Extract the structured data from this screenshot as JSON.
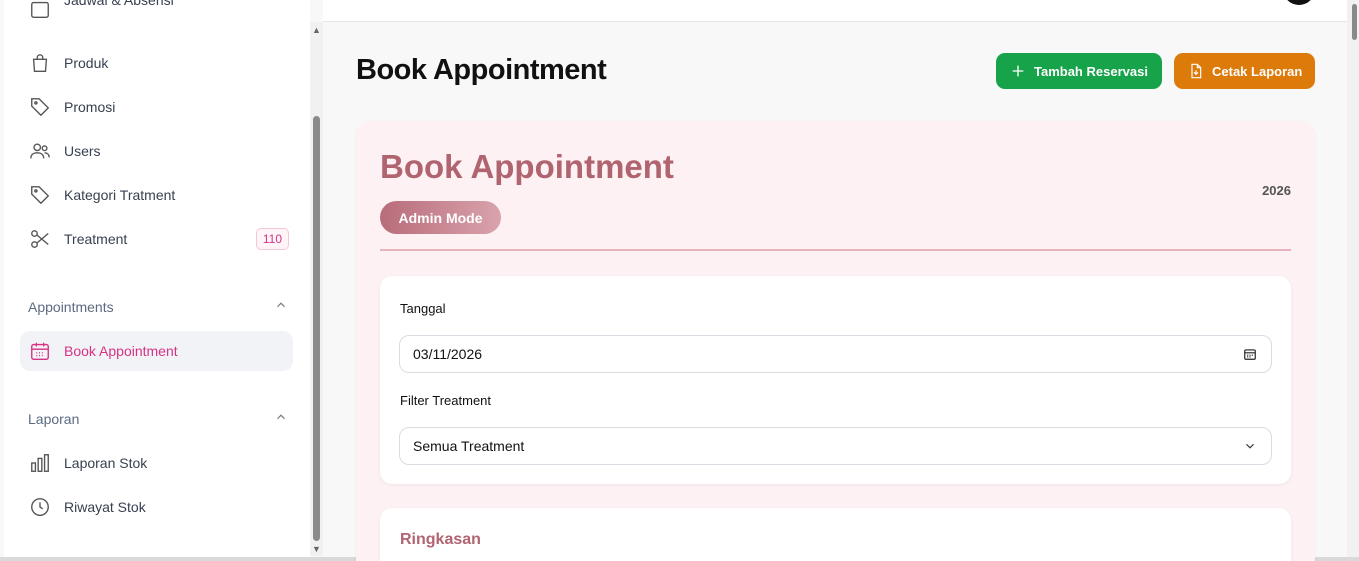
{
  "sidebar": {
    "items": [
      {
        "label": "Jadwal & Absensi",
        "icon": "calendar-icon"
      },
      {
        "label": "Produk",
        "icon": "shopping-bag-icon"
      },
      {
        "label": "Promosi",
        "icon": "tag-icon"
      },
      {
        "label": "Users",
        "icon": "users-icon"
      },
      {
        "label": "Kategori Tratment",
        "icon": "tag-icon"
      },
      {
        "label": "Treatment",
        "icon": "scissors-icon",
        "badge": "110"
      }
    ],
    "sections": [
      {
        "label": "Appointments",
        "items": [
          {
            "label": "Book Appointment",
            "icon": "calendar-icon",
            "active": true
          }
        ]
      },
      {
        "label": "Laporan",
        "items": [
          {
            "label": "Laporan Stok",
            "icon": "bar-chart-icon"
          },
          {
            "label": "Riwayat Stok",
            "icon": "clock-icon"
          }
        ]
      }
    ]
  },
  "header": {
    "title": "Book Appointment",
    "add_button": "Tambah Reservasi",
    "print_button": "Cetak Laporan"
  },
  "card": {
    "title": "Book Appointment",
    "year": "2026",
    "mode": "Admin Mode"
  },
  "form": {
    "date_label": "Tanggal",
    "date_value": "03/11/2026",
    "filter_label": "Filter Treatment",
    "filter_value": "Semua Treatment"
  },
  "summary": {
    "title": "Ringkasan"
  },
  "colors": {
    "accent": "#d63384",
    "card_title": "#b0646f",
    "green_button": "#16a34a",
    "orange_button": "#dc7a0a"
  }
}
